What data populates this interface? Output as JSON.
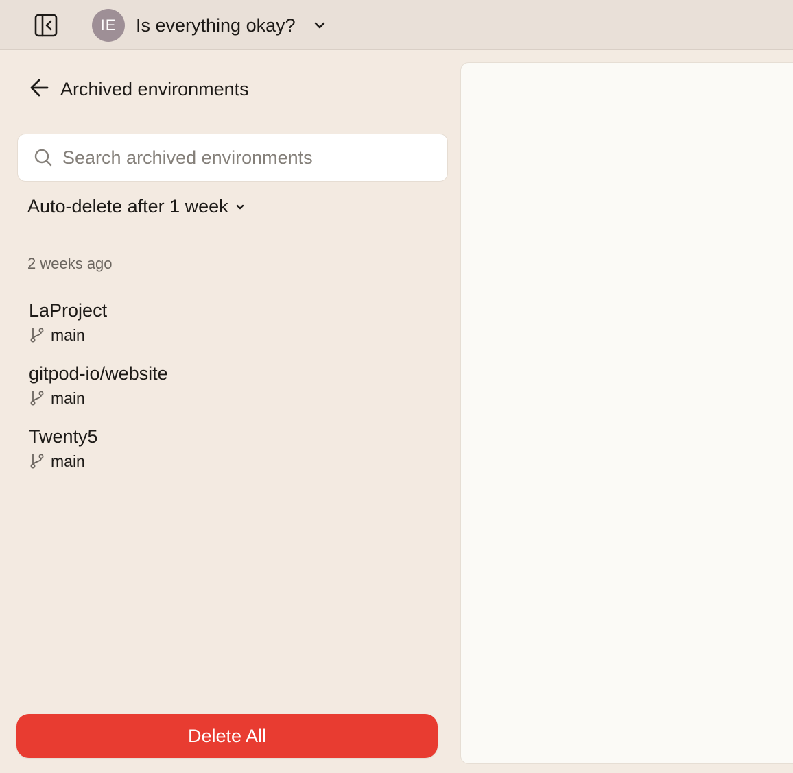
{
  "header": {
    "avatar_initials": "IE",
    "org_name": "Is everything okay?",
    "icons": {
      "sidebar_toggle": "sidebar-collapse-icon",
      "org_dropdown": "chevron-down-icon"
    }
  },
  "panel": {
    "title": "Archived environments",
    "back_icon": "arrow-left-icon"
  },
  "search": {
    "placeholder": "Search archived environments",
    "value": "",
    "icon": "search-icon"
  },
  "auto_delete": {
    "label": "Auto-delete after 1 week",
    "icon": "chevron-down-icon"
  },
  "groups": [
    {
      "label": "2 weeks ago",
      "environments": [
        {
          "name": "LaProject",
          "branch": "main"
        },
        {
          "name": "gitpod-io/website",
          "branch": "main"
        },
        {
          "name": "Twenty5",
          "branch": "main"
        }
      ]
    }
  ],
  "actions": {
    "delete_all_label": "Delete All"
  },
  "colors": {
    "accent_danger": "#e83c31",
    "avatar_bg": "#9e8f96",
    "topbar_bg": "#e9e0d8",
    "panel_bg": "#f3eae1",
    "detail_bg": "#fbfaf6"
  }
}
